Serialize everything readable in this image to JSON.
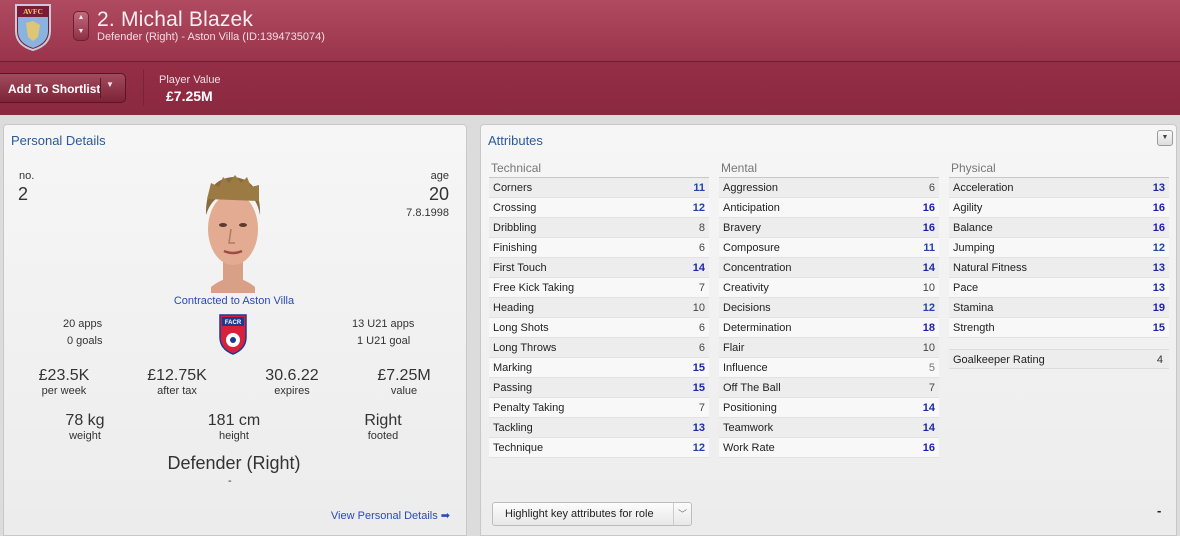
{
  "header": {
    "player_name": "2. Michal Blazek",
    "subtitle": "Defender (Right) - Aston Villa (ID:1394735074)",
    "crest_text": "AVFC",
    "add_to_shortlist": "Add To Shortlist",
    "player_value_caption": "Player Value",
    "player_value": "£7.25M",
    "colors": {
      "header": "#9a344c",
      "link": "#2a4ab8"
    }
  },
  "personal": {
    "title": "Personal Details",
    "no_label": "no.",
    "no_value": "2",
    "age_label": "age",
    "age_value": "20",
    "dob": "7.8.1998",
    "contract": "Contracted to Aston Villa",
    "apps": "20 apps",
    "goals": "0 goals",
    "u21_apps": "13 U21 apps",
    "u21_goals": "1 U21 goal",
    "badge_text": "FACR",
    "stats": {
      "wage_value": "£23.5K",
      "wage_caption": "per week",
      "aftertax_value": "£12.75K",
      "aftertax_caption": "after tax",
      "expires_value": "30.6.22",
      "expires_caption": "expires",
      "value_value": "£7.25M",
      "value_caption": "value",
      "weight_value": "78 kg",
      "weight_caption": "weight",
      "height_value": "181 cm",
      "height_caption": "height",
      "foot_value": "Right",
      "foot_caption": "footed"
    },
    "position": "Defender (Right)",
    "position_dash": "-",
    "view_link": "View Personal Details"
  },
  "attributes": {
    "title": "Attributes",
    "technical": {
      "header": "Technical",
      "rows": [
        {
          "name": "Corners",
          "value": "11"
        },
        {
          "name": "Crossing",
          "value": "12"
        },
        {
          "name": "Dribbling",
          "value": "8"
        },
        {
          "name": "Finishing",
          "value": "6"
        },
        {
          "name": "First Touch",
          "value": "14"
        },
        {
          "name": "Free Kick Taking",
          "value": "7"
        },
        {
          "name": "Heading",
          "value": "10"
        },
        {
          "name": "Long Shots",
          "value": "6"
        },
        {
          "name": "Long Throws",
          "value": "6"
        },
        {
          "name": "Marking",
          "value": "15"
        },
        {
          "name": "Passing",
          "value": "15"
        },
        {
          "name": "Penalty Taking",
          "value": "7"
        },
        {
          "name": "Tackling",
          "value": "13"
        },
        {
          "name": "Technique",
          "value": "12"
        }
      ]
    },
    "mental": {
      "header": "Mental",
      "rows": [
        {
          "name": "Aggression",
          "value": "6"
        },
        {
          "name": "Anticipation",
          "value": "16"
        },
        {
          "name": "Bravery",
          "value": "16"
        },
        {
          "name": "Composure",
          "value": "11"
        },
        {
          "name": "Concentration",
          "value": "14"
        },
        {
          "name": "Creativity",
          "value": "10"
        },
        {
          "name": "Decisions",
          "value": "12"
        },
        {
          "name": "Determination",
          "value": "18"
        },
        {
          "name": "Flair",
          "value": "10"
        },
        {
          "name": "Influence",
          "value": "5"
        },
        {
          "name": "Off The Ball",
          "value": "7"
        },
        {
          "name": "Positioning",
          "value": "14"
        },
        {
          "name": "Teamwork",
          "value": "14"
        },
        {
          "name": "Work Rate",
          "value": "16"
        }
      ]
    },
    "physical": {
      "header": "Physical",
      "rows": [
        {
          "name": "Acceleration",
          "value": "13"
        },
        {
          "name": "Agility",
          "value": "16"
        },
        {
          "name": "Balance",
          "value": "16"
        },
        {
          "name": "Jumping",
          "value": "12"
        },
        {
          "name": "Natural Fitness",
          "value": "13"
        },
        {
          "name": "Pace",
          "value": "13"
        },
        {
          "name": "Stamina",
          "value": "19"
        },
        {
          "name": "Strength",
          "value": "15"
        }
      ]
    },
    "goalkeeper_rating_label": "Goalkeeper Rating",
    "goalkeeper_rating_value": "4",
    "highlight_select": "Highlight key attributes for role",
    "footer_dash": "-"
  }
}
